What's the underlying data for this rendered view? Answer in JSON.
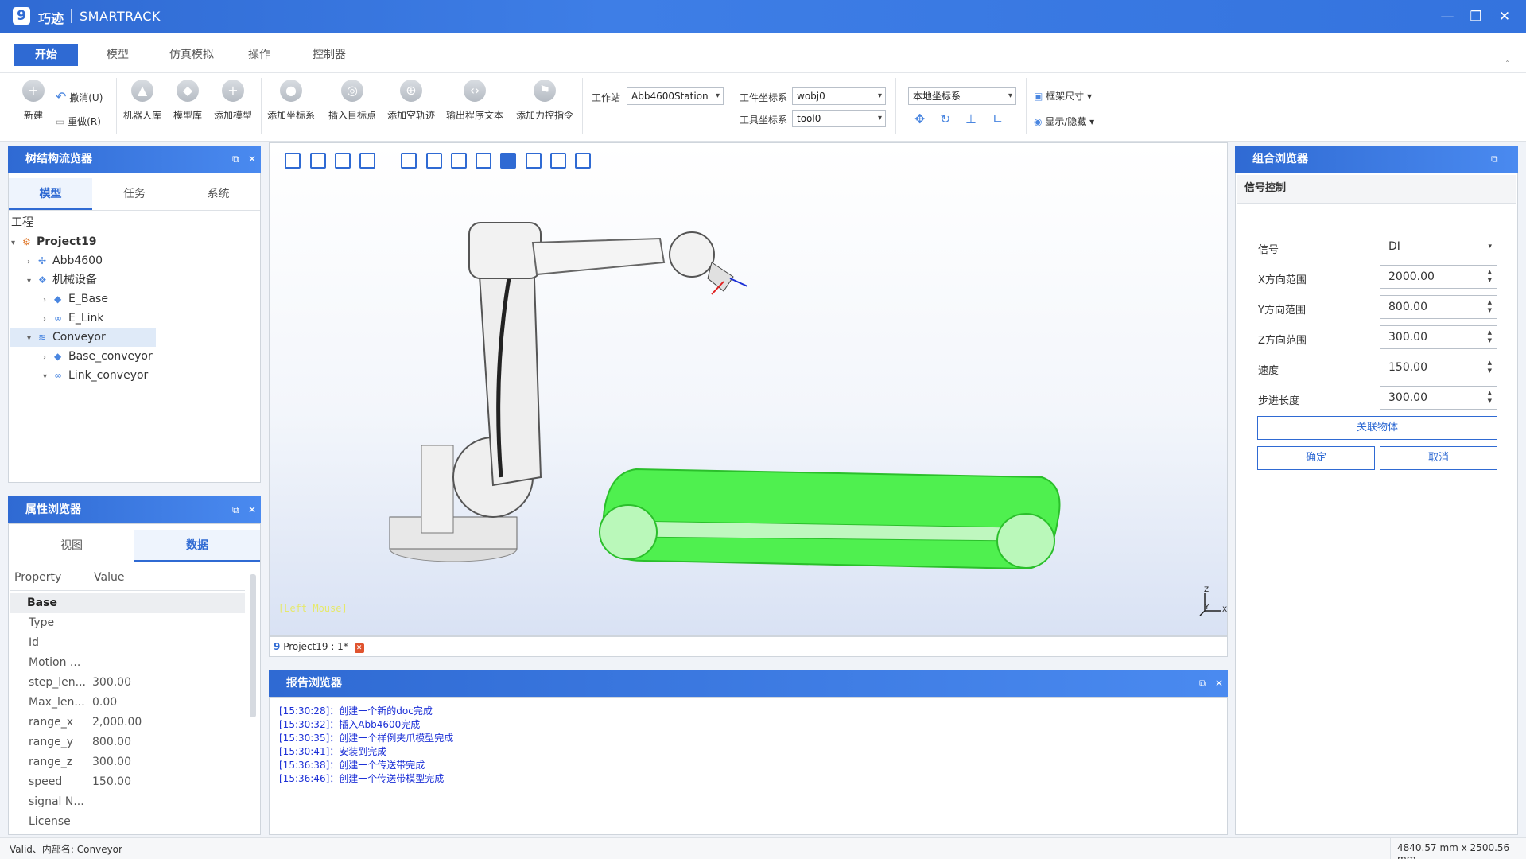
{
  "titlebar": {
    "logo": "9",
    "brand": "巧迹",
    "product": "SMARTRACK",
    "minimize_icon": "minimize-icon",
    "restore_icon": "restore-icon",
    "close_icon": "close-icon"
  },
  "tabs": [
    {
      "label": "开始",
      "active": true
    },
    {
      "label": "模型"
    },
    {
      "label": "仿真模拟"
    },
    {
      "label": "操作"
    },
    {
      "label": "控制器"
    }
  ],
  "ribbon": {
    "new": "新建",
    "undo": "撤消(U)",
    "redo": "重做(R)",
    "robot_lib": "机器人库",
    "model_lib": "模型库",
    "add_model": "添加模型",
    "add_frame": "添加坐标系",
    "insert_target": "插入目标点",
    "add_path": "添加空轨迹",
    "export_program": "输出程序文本",
    "add_force_cmd": "添加力控指令",
    "station_label": "工作站",
    "station_value": "Abb4600Station",
    "wobj_label": "工件坐标系",
    "wobj_value": "wobj0",
    "tool_label": "工具坐标系",
    "tool_value": "tool0",
    "coord_value": "本地坐标系",
    "frame_size": "框架尺寸",
    "show_hide": "显示/隐藏"
  },
  "tree_panel": {
    "title": "树结构流览器",
    "tabs": [
      "模型",
      "任务",
      "系统"
    ],
    "root_label": "工程",
    "items": [
      {
        "label": "Project19",
        "icon": "project-icon"
      },
      {
        "label": "Abb4600",
        "icon": "robot-icon"
      },
      {
        "label": "机械设备",
        "icon": "mechanism-icon"
      },
      {
        "label": "E_Base",
        "icon": "layer-icon"
      },
      {
        "label": "E_Link",
        "icon": "link-icon"
      },
      {
        "label": "Conveyor",
        "icon": "conveyor-icon"
      },
      {
        "label": "Base_conveyor",
        "icon": "layer-icon"
      },
      {
        "label": "Link_conveyor",
        "icon": "link-icon"
      }
    ]
  },
  "props_panel": {
    "title": "属性浏览器",
    "tabs": [
      "视图",
      "数据"
    ],
    "col_property": "Property",
    "col_value": "Value",
    "group": "Base",
    "rows": [
      {
        "k": "Type",
        "v": ""
      },
      {
        "k": "Id",
        "v": ""
      },
      {
        "k": "Motion ...",
        "v": ""
      },
      {
        "k": "step_len...",
        "v": "300.00"
      },
      {
        "k": "Max_len...",
        "v": "0.00"
      },
      {
        "k": "range_x",
        "v": "2,000.00"
      },
      {
        "k": "range_y",
        "v": "800.00"
      },
      {
        "k": "range_z",
        "v": "300.00"
      },
      {
        "k": "speed",
        "v": "150.00"
      },
      {
        "k": "signal N...",
        "v": ""
      },
      {
        "k": "License",
        "v": ""
      }
    ]
  },
  "viewport": {
    "overlay_text": "[Left Mouse]",
    "doc_tab": "Project19 : 1*",
    "axis_z": "Z",
    "axis_y": "Y",
    "axis_x": "X",
    "colors": {
      "conveyor": "#4ff04f",
      "conveyor_edge": "#2bbf2b",
      "robot": "#e8e8e8"
    }
  },
  "report_panel": {
    "title": "报告浏览器",
    "logs": [
      "[15:30:28]：创建一个新的doc完成",
      "[15:30:32]：插入Abb4600完成",
      "[15:30:35]：创建一个样例夹爪模型完成",
      "[15:30:41]：安装到完成",
      "[15:36:38]：创建一个传送带完成",
      "[15:36:46]：创建一个传送带模型完成"
    ]
  },
  "combo_panel": {
    "title": "组合浏览器",
    "section": "信号控制",
    "fields": [
      {
        "label": "信号",
        "value": "DI",
        "type": "select"
      },
      {
        "label": "X方向范围",
        "value": "2000.00",
        "type": "spin"
      },
      {
        "label": "Y方向范围",
        "value": "800.00",
        "type": "spin"
      },
      {
        "label": "Z方向范围",
        "value": "300.00",
        "type": "spin"
      },
      {
        "label": "速度",
        "value": "150.00",
        "type": "spin"
      },
      {
        "label": "步进长度",
        "value": "300.00",
        "type": "spin"
      }
    ],
    "link_button": "关联物体",
    "ok_button": "确定",
    "cancel_button": "取消"
  },
  "statusbar": {
    "left": "Valid、内部名: Conveyor",
    "right": "4840.57 mm x 2500.56 mm"
  },
  "accent": "#2f6ad3"
}
